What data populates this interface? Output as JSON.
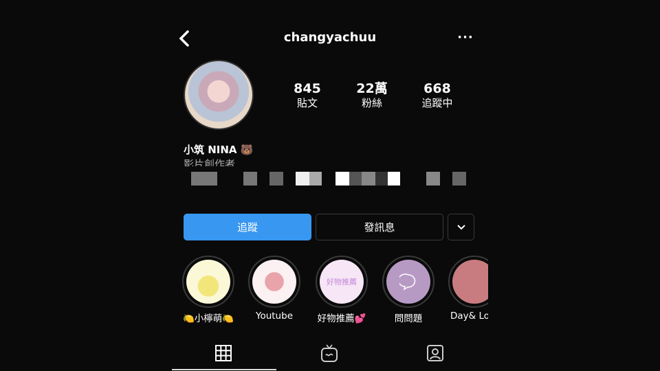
{
  "header": {
    "username": "changyachuu",
    "back_icon": "chevron-left-icon",
    "more_label": "···"
  },
  "stats": [
    {
      "value": "845",
      "label": "貼文"
    },
    {
      "value": "22萬",
      "label": "粉絲"
    },
    {
      "value": "668",
      "label": "追蹤中"
    }
  ],
  "profile": {
    "name": "小筑 NINA 🐻",
    "bio": "影片創作者"
  },
  "buttons": {
    "follow": "追蹤",
    "message": "發訊息"
  },
  "highlights": [
    {
      "label": "🍋小檸萌🍋",
      "color": "#f6f3c8"
    },
    {
      "label": "Youtube",
      "color": "#fbf0f2"
    },
    {
      "label": "好物推薦💕",
      "color": "#f6e6f6"
    },
    {
      "label": "問問題",
      "color": "#b79ac4"
    },
    {
      "label": "Day& Lo",
      "color": "#c97c80"
    }
  ],
  "tabs": [
    {
      "icon": "grid-icon"
    },
    {
      "icon": "igtv-icon"
    },
    {
      "icon": "tagged-icon"
    }
  ]
}
